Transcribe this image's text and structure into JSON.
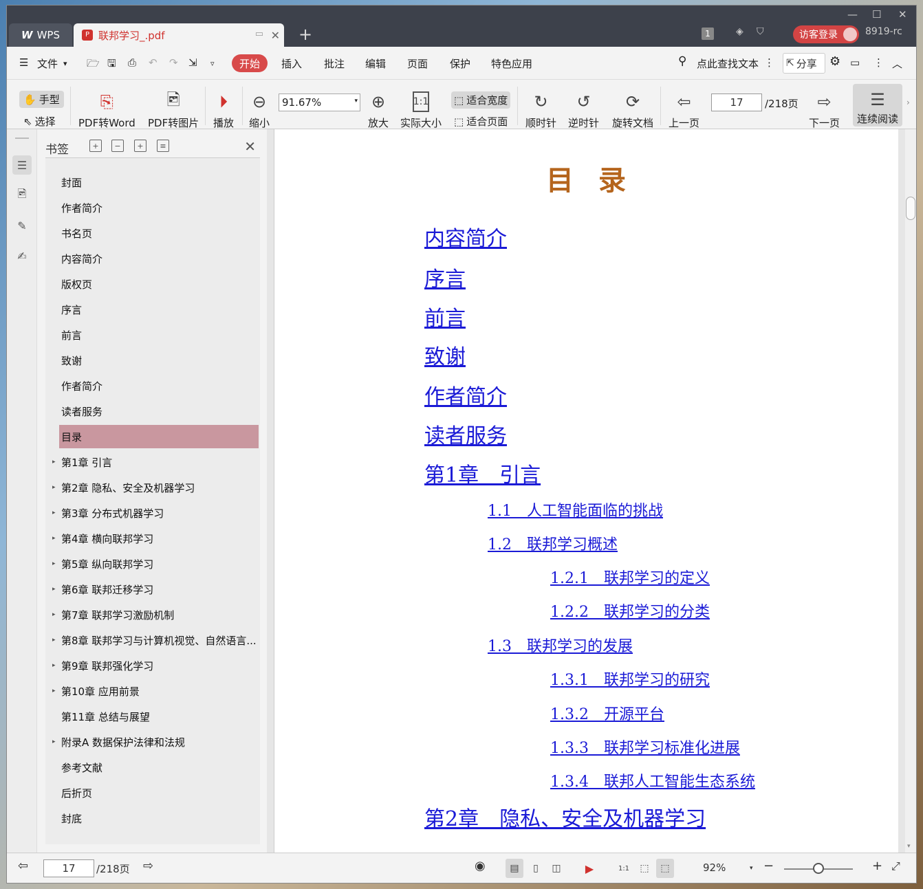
{
  "titlebar": {
    "app_tab": "WPS",
    "doc_tab": "联邦学习_.pdf",
    "page_indicator": "1",
    "login_label": "访客登录",
    "user_id": "8919-rc"
  },
  "menubar": {
    "file": "文件",
    "items": [
      "开始",
      "插入",
      "批注",
      "编辑",
      "页面",
      "保护",
      "特色应用"
    ],
    "search_placeholder": "点此查找文本",
    "share": "分享"
  },
  "toolbar": {
    "hand": "手型",
    "select": "选择",
    "pdf_word": "PDF转Word",
    "pdf_image": "PDF转图片",
    "play": "播放",
    "zoom_out": "缩小",
    "zoom_value": "91.67%",
    "zoom_in": "放大",
    "actual_size": "实际大小",
    "fit_width": "适合宽度",
    "fit_page": "适合页面",
    "rotate_cw": "顺时针",
    "rotate_ccw": "逆时针",
    "rotate_doc": "旋转文档",
    "prev_page": "上一页",
    "current_page": "17",
    "total_pages": "/218页",
    "next_page": "下一页",
    "continuous": "连续阅读"
  },
  "bookmarks": {
    "title": "书签",
    "items": [
      {
        "label": "封面",
        "expandable": false,
        "selected": false
      },
      {
        "label": "作者简介",
        "expandable": false,
        "selected": false
      },
      {
        "label": "书名页",
        "expandable": false,
        "selected": false
      },
      {
        "label": "内容简介",
        "expandable": false,
        "selected": false
      },
      {
        "label": "版权页",
        "expandable": false,
        "selected": false
      },
      {
        "label": "序言",
        "expandable": false,
        "selected": false
      },
      {
        "label": "前言",
        "expandable": false,
        "selected": false
      },
      {
        "label": "致谢",
        "expandable": false,
        "selected": false
      },
      {
        "label": "作者简介",
        "expandable": false,
        "selected": false
      },
      {
        "label": "读者服务",
        "expandable": false,
        "selected": false
      },
      {
        "label": "目录",
        "expandable": false,
        "selected": true
      },
      {
        "label": "第1章 引言",
        "expandable": true,
        "selected": false
      },
      {
        "label": "第2章 隐私、安全及机器学习",
        "expandable": true,
        "selected": false
      },
      {
        "label": "第3章 分布式机器学习",
        "expandable": true,
        "selected": false
      },
      {
        "label": "第4章 横向联邦学习",
        "expandable": true,
        "selected": false
      },
      {
        "label": "第5章 纵向联邦学习",
        "expandable": true,
        "selected": false
      },
      {
        "label": "第6章 联邦迁移学习",
        "expandable": true,
        "selected": false
      },
      {
        "label": "第7章 联邦学习激励机制",
        "expandable": true,
        "selected": false
      },
      {
        "label": "第8章 联邦学习与计算机视觉、自然语言...",
        "expandable": true,
        "selected": false
      },
      {
        "label": "第9章 联邦强化学习",
        "expandable": true,
        "selected": false
      },
      {
        "label": "第10章 应用前景",
        "expandable": true,
        "selected": false
      },
      {
        "label": "第11章 总结与展望",
        "expandable": false,
        "selected": false
      },
      {
        "label": "附录A 数据保护法律和法规",
        "expandable": true,
        "selected": false
      },
      {
        "label": "参考文献",
        "expandable": false,
        "selected": false
      },
      {
        "label": "后折页",
        "expandable": false,
        "selected": false
      },
      {
        "label": "封底",
        "expandable": false,
        "selected": false
      }
    ]
  },
  "document": {
    "title": "目录",
    "toc": [
      {
        "text": "内容简介",
        "level": 1
      },
      {
        "text": "序言",
        "level": 1
      },
      {
        "text": "前言",
        "level": 1
      },
      {
        "text": "致谢",
        "level": 1
      },
      {
        "text": "作者简介",
        "level": 1
      },
      {
        "text": "读者服务",
        "level": 1
      },
      {
        "text": "第1章　引言",
        "level": 1
      },
      {
        "text": "1.1　人工智能面临的挑战",
        "level": 2
      },
      {
        "text": "1.2　联邦学习概述",
        "level": 2
      },
      {
        "text": "1.2.1　联邦学习的定义",
        "level": 3
      },
      {
        "text": "1.2.2　联邦学习的分类",
        "level": 3
      },
      {
        "text": "1.3　联邦学习的发展",
        "level": 2
      },
      {
        "text": "1.3.1　联邦学习的研究",
        "level": 3
      },
      {
        "text": "1.3.2　开源平台",
        "level": 3
      },
      {
        "text": "1.3.3　联邦学习标准化进展",
        "level": 3
      },
      {
        "text": "1.3.4　联邦人工智能生态系统",
        "level": 3
      },
      {
        "text": "第2章　隐私、安全及机器学习",
        "level": 1
      }
    ]
  },
  "statusbar": {
    "current_page": "17",
    "total_pages": "/218页",
    "zoom": "92%"
  },
  "colors": {
    "accent": "#d84a4a",
    "toc_link": "#1a1ad6",
    "toc_title": "#b5651d",
    "bookmark_selected": "#c9979f"
  }
}
